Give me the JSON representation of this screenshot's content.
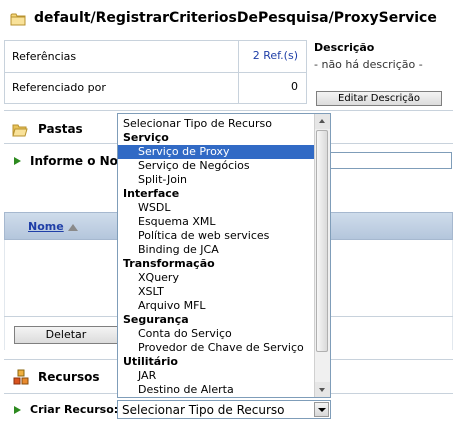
{
  "header": {
    "title": "default/RegistrarCriteriosDePesquisa/ProxyService",
    "icon": "folder-icon"
  },
  "references": {
    "referencias_label": "Referências",
    "referencias_value": "2 Ref.(s)",
    "referenciado_label": "Referenciado por",
    "referenciado_value": "0"
  },
  "description": {
    "label": "Descrição",
    "value": "- não há descrição -",
    "edit_button": "Editar Descrição"
  },
  "pastas": {
    "label": "Pastas",
    "informe_label": "Informe o Nom",
    "table_header": "Nome",
    "delete_button": "Deletar"
  },
  "recursos": {
    "label": "Recursos",
    "criar_label": "Criar Recurso:",
    "select_value": "Selecionar Tipo de Recurso"
  },
  "dropdown": {
    "options": [
      {
        "type": "item",
        "label": "Selecionar Tipo de Recurso",
        "first": true
      },
      {
        "type": "group",
        "label": "Serviço"
      },
      {
        "type": "item",
        "label": "Serviço de Proxy",
        "selected": true
      },
      {
        "type": "item",
        "label": "Serviço de Negócios"
      },
      {
        "type": "item",
        "label": "Split-Join"
      },
      {
        "type": "group",
        "label": "Interface"
      },
      {
        "type": "item",
        "label": "WSDL"
      },
      {
        "type": "item",
        "label": "Esquema XML"
      },
      {
        "type": "item",
        "label": "Política de web services"
      },
      {
        "type": "item",
        "label": "Binding de JCA"
      },
      {
        "type": "group",
        "label": "Transformação"
      },
      {
        "type": "item",
        "label": "XQuery"
      },
      {
        "type": "item",
        "label": "XSLT"
      },
      {
        "type": "item",
        "label": "Arquivo MFL"
      },
      {
        "type": "group",
        "label": "Segurança"
      },
      {
        "type": "item",
        "label": "Conta do Serviço"
      },
      {
        "type": "item",
        "label": "Provedor de Chave de Serviço"
      },
      {
        "type": "group",
        "label": "Utilitário"
      },
      {
        "type": "item",
        "label": "JAR"
      },
      {
        "type": "item",
        "label": "Destino de Alerta"
      }
    ]
  },
  "colors": {
    "link": "#1f3fa7",
    "selection": "#316ac5",
    "arrow": "#2d8a1f"
  }
}
